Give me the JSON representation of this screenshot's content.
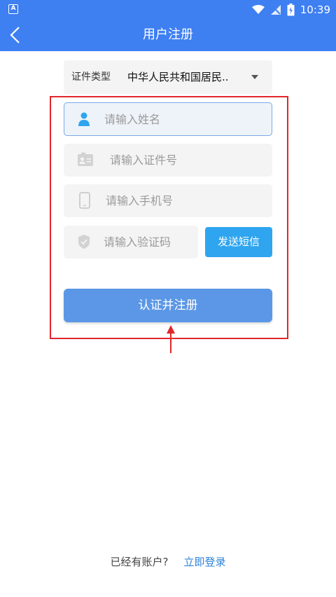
{
  "status_bar": {
    "time": "10:39",
    "app_badge": "A"
  },
  "header": {
    "title": "用户注册"
  },
  "doc_type": {
    "label": "证件类型",
    "value": "中华人民共和国居民.."
  },
  "fields": {
    "name_placeholder": "请输入姓名",
    "id_placeholder": "请输入证件号",
    "phone_placeholder": "请输入手机号",
    "code_placeholder": "请输入验证码"
  },
  "buttons": {
    "send_sms": "发送短信",
    "submit": "认证并注册"
  },
  "footer": {
    "question": "已经有账户?",
    "login": "立即登录"
  },
  "colors": {
    "header_bg": "#3e7ff2",
    "send_sms_bg": "#2fa5ef",
    "submit_bg": "#5b97e6",
    "link": "#2b82d9",
    "annotation": "#e0262b"
  },
  "icons": {
    "name": "person-icon",
    "id": "id-card-icon",
    "phone": "phone-icon",
    "code": "shield-icon"
  }
}
